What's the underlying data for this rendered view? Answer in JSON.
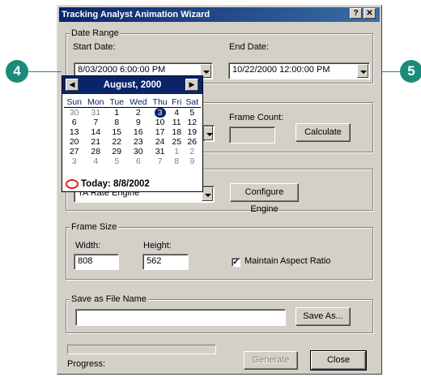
{
  "window": {
    "title": "Tracking Analyst Animation Wizard",
    "help_glyph": "?",
    "close_glyph": "✕"
  },
  "date_range": {
    "group_label": "Date Range",
    "start_label": "Start Date:",
    "start_value": "8/03/2000  6:00:00 PM",
    "end_label": "End Date:",
    "end_value": "10/22/2000 12:00:00 PM"
  },
  "frames": {
    "count_label": "Frame Count:",
    "count_value": "",
    "calculate_label": "Calculate"
  },
  "engine": {
    "partial_value": "TA Rate Engine",
    "configure_label": "Configure Engine"
  },
  "frame_size": {
    "group_label": "Frame Size",
    "width_label": "Width:",
    "width_value": "808",
    "height_label": "Height:",
    "height_value": "562",
    "aspect_label": "Maintain Aspect Ratio",
    "aspect_checked": true
  },
  "save": {
    "group_label": "Save as File Name",
    "value": "",
    "save_as_label": "Save As..."
  },
  "footer": {
    "progress_label": "Progress:",
    "progress_value": 0,
    "generate_label": "Generate",
    "close_label": "Close"
  },
  "calendar": {
    "month_label": "August, 2000",
    "prev_glyph": "◀",
    "next_glyph": "▶",
    "weekdays": [
      "Sun",
      "Mon",
      "Tue",
      "Wed",
      "Thu",
      "Fri",
      "Sat"
    ],
    "weeks": [
      [
        {
          "d": "30",
          "o": true
        },
        {
          "d": "31",
          "o": true
        },
        {
          "d": "1"
        },
        {
          "d": "2"
        },
        {
          "d": "3",
          "s": true
        },
        {
          "d": "4"
        },
        {
          "d": "5"
        }
      ],
      [
        {
          "d": "6"
        },
        {
          "d": "7"
        },
        {
          "d": "8"
        },
        {
          "d": "9"
        },
        {
          "d": "10"
        },
        {
          "d": "11"
        },
        {
          "d": "12"
        }
      ],
      [
        {
          "d": "13"
        },
        {
          "d": "14"
        },
        {
          "d": "15"
        },
        {
          "d": "16"
        },
        {
          "d": "17"
        },
        {
          "d": "18"
        },
        {
          "d": "19"
        }
      ],
      [
        {
          "d": "20"
        },
        {
          "d": "21"
        },
        {
          "d": "22"
        },
        {
          "d": "23"
        },
        {
          "d": "24"
        },
        {
          "d": "25"
        },
        {
          "d": "26"
        }
      ],
      [
        {
          "d": "27"
        },
        {
          "d": "28"
        },
        {
          "d": "29"
        },
        {
          "d": "30"
        },
        {
          "d": "31"
        },
        {
          "d": "1",
          "o": true
        },
        {
          "d": "2",
          "o": true
        }
      ],
      [
        {
          "d": "3",
          "o": true
        },
        {
          "d": "4",
          "o": true
        },
        {
          "d": "5",
          "o": true
        },
        {
          "d": "6",
          "o": true
        },
        {
          "d": "7",
          "o": true
        },
        {
          "d": "8",
          "o": true
        },
        {
          "d": "9",
          "o": true
        }
      ]
    ],
    "today_label": "Today: 8/8/2002"
  },
  "callouts": {
    "left_number": "4",
    "right_number": "5",
    "color": "#1b8a7a"
  }
}
